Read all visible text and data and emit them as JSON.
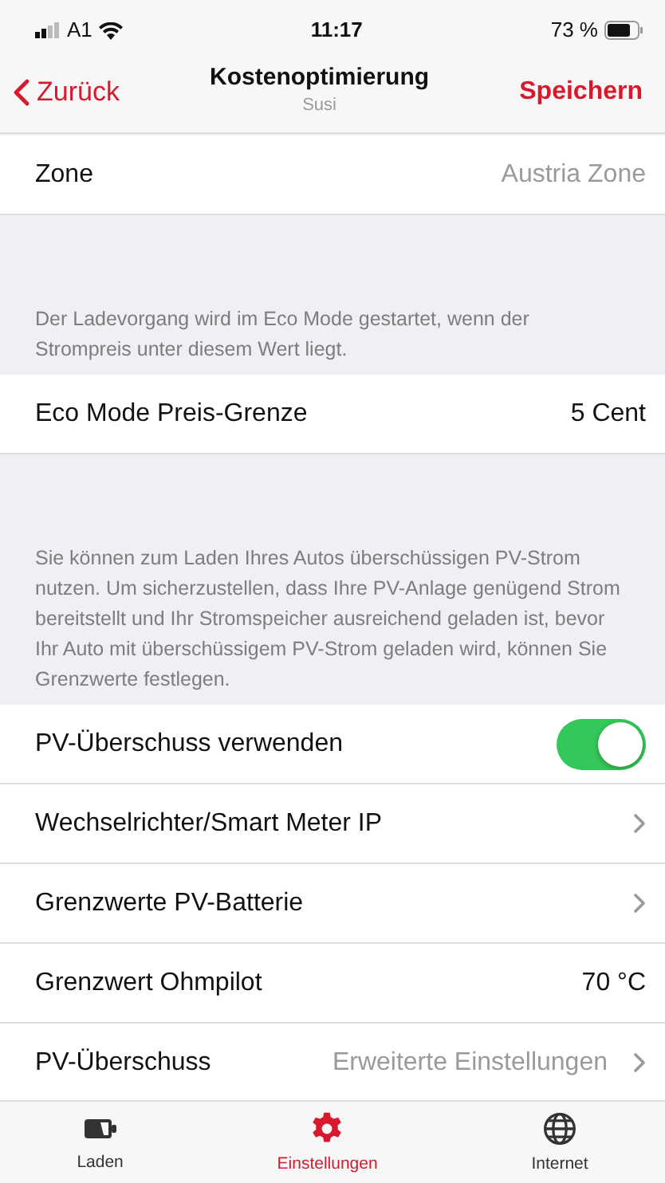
{
  "status_bar": {
    "carrier": "A1",
    "time": "11:17",
    "battery": "73 %"
  },
  "nav": {
    "back": "Zurück",
    "title": "Kostenoptimierung",
    "subtitle": "Susi",
    "action": "Speichern"
  },
  "sections": [
    {
      "rows": [
        {
          "kind": "value",
          "label": "Zone",
          "value": "Austria Zone",
          "muted": true
        }
      ]
    },
    {
      "header": "Der Ladevorgang wird im Eco Mode gestartet, wenn der Strompreis unter diesem Wert liegt.",
      "rows": [
        {
          "kind": "value",
          "label": "Eco Mode Preis-Grenze",
          "value": "5 Cent",
          "muted": false
        }
      ]
    },
    {
      "header": "Sie können zum Laden Ihres Autos überschüssigen PV-Strom nutzen. Um sicherzustellen, dass Ihre PV-Anlage genügend Strom bereitstellt und Ihr Stromspeicher ausreichend geladen ist, bevor Ihr Auto mit überschüssigem PV-Strom geladen wird, können Sie Grenzwerte festlegen.",
      "rows": [
        {
          "kind": "toggle",
          "label": "PV-Überschuss verwenden",
          "on": true
        },
        {
          "kind": "chevron",
          "label": "Wechselrichter/Smart Meter IP"
        },
        {
          "kind": "chevron",
          "label": "Grenzwerte PV-Batterie"
        },
        {
          "kind": "value",
          "label": "Grenzwert Ohmpilot",
          "value": "70 °C",
          "muted": false
        },
        {
          "kind": "chevron",
          "label": "PV-Überschuss",
          "value": "Erweiterte Einstellungen"
        }
      ]
    }
  ],
  "tabs": [
    {
      "kind": "battery",
      "label": "Laden",
      "selected": false
    },
    {
      "kind": "gear",
      "label": "Einstellungen",
      "selected": true
    },
    {
      "kind": "globe",
      "label": "Internet",
      "selected": false
    }
  ]
}
